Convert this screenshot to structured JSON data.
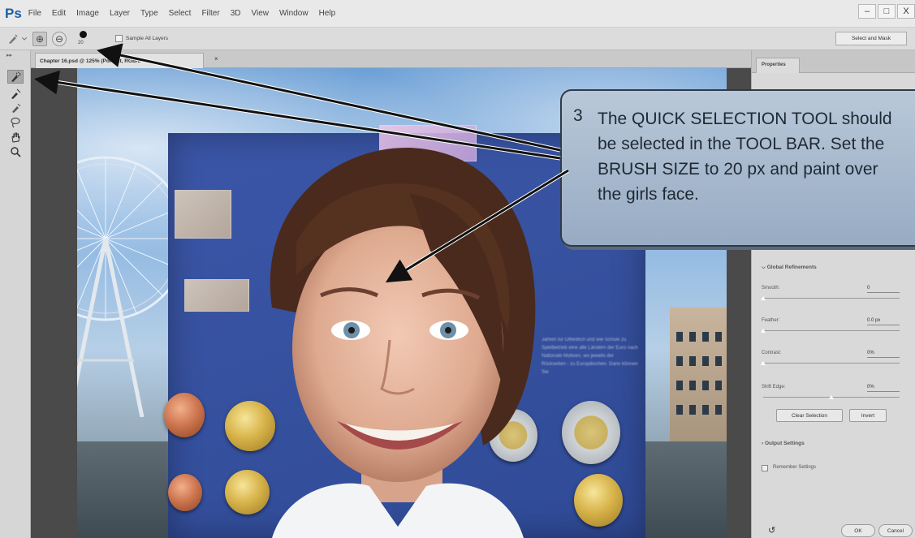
{
  "app": {
    "logo": "Ps"
  },
  "menubar": {
    "items": [
      "File",
      "Edit",
      "Image",
      "Layer",
      "Type",
      "Select",
      "Filter",
      "3D",
      "View",
      "Window",
      "Help"
    ],
    "window_controls": [
      "–",
      "□",
      "X"
    ]
  },
  "options_bar": {
    "brush_size": "20",
    "sample_all_layers_label": "Sample All Layers",
    "select_and_mask_label": "Select and Mask"
  },
  "document": {
    "tab_title": "Chapter 16.psd @ 125% (Portrait, RGB/8",
    "tab_close": "×"
  },
  "properties_panel": {
    "tab_label": "Properties",
    "global_refinements_label": "Global Refinements",
    "smooth": {
      "label": "Smooth:",
      "value": "0",
      "level": 0
    },
    "feather": {
      "label": "Feather:",
      "value": "0.0 px",
      "level": 0
    },
    "contrast": {
      "label": "Contrast:",
      "value": "0%",
      "level": 0
    },
    "shift_edge": {
      "label": "Shift Edge:",
      "value": "0%",
      "level": 0.5
    },
    "clear_selection_label": "Clear Selection",
    "invert_label": "Invert",
    "output_settings_label": "Output Settings",
    "remember_settings_label": "Remember Settings",
    "ok_label": "OK",
    "cancel_label": "Cancel"
  },
  "photo_text": "Jahren für Offentlich und wie Schule zu Spielbetrieb eine alle Ländern der Euro nach Nationale Motiven, wo jeweils der Rückseiten - zu Europäischen. Dann können Sie",
  "callout": {
    "number": "3",
    "text": "The QUICK SELECTION TOOL should\nbe selected in the TOOL BAR. Set the\nBRUSH SIZE to 20 px and paint over\nthe girls face."
  },
  "colors": {
    "accent_blue": "#1b5fa8",
    "callout_fill": "#a9bbd0",
    "arrow": "#111111"
  },
  "tools": [
    "quick-selection-icon",
    "refine-edge-brush-icon",
    "brush-icon",
    "lasso-icon",
    "hand-icon",
    "zoom-icon"
  ]
}
